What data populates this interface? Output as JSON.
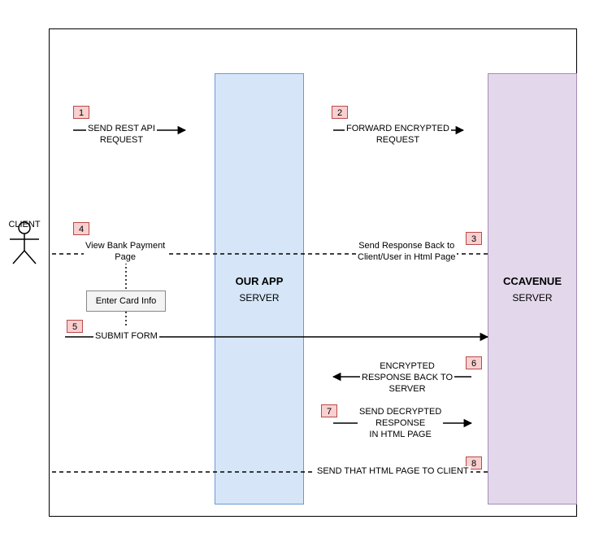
{
  "actor": {
    "label": "CLIENT"
  },
  "lifelines": {
    "app": {
      "title": "OUR APP",
      "sub": "SERVER"
    },
    "ccav": {
      "title": "CCAVENUE",
      "sub": "SERVER"
    }
  },
  "steps": {
    "s1": {
      "num": "1",
      "label": "SEND REST API\nREQUEST"
    },
    "s2": {
      "num": "2",
      "label": "FORWARD ENCRYPTED\nREQUEST"
    },
    "s3": {
      "num": "3",
      "label": "Send Response Back to\nClient/User in Html Page"
    },
    "s4": {
      "num": "4",
      "label": "View Bank Payment\nPage"
    },
    "card": {
      "label": "Enter Card Info"
    },
    "s5": {
      "num": "5",
      "label": "SUBMIT FORM"
    },
    "s6": {
      "num": "6",
      "label": "ENCRYPTED\nRESPONSE BACK TO\nSERVER"
    },
    "s7": {
      "num": "7",
      "label": "SEND DECRYPTED\nRESPONSE\nIN HTML PAGE"
    },
    "s8": {
      "num": "8",
      "label": "SEND THAT HTML PAGE TO CLIENT"
    }
  }
}
